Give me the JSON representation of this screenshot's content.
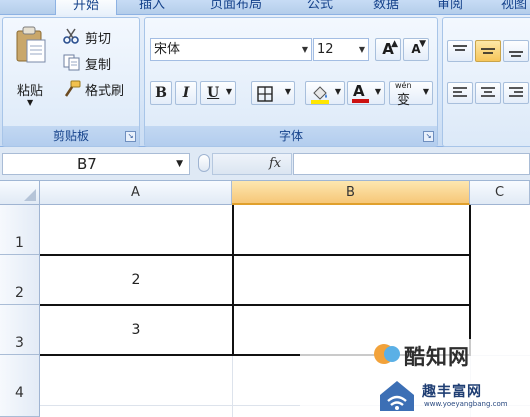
{
  "tabs": [
    {
      "label": "开始",
      "active": true
    },
    {
      "label": "插入",
      "active": false
    },
    {
      "label": "页面布局",
      "active": false
    },
    {
      "label": "公式",
      "active": false
    },
    {
      "label": "数据",
      "active": false
    },
    {
      "label": "审阅",
      "active": false
    },
    {
      "label": "视图",
      "active": false
    }
  ],
  "clipboard": {
    "paste_label": "粘贴",
    "cut_label": "剪切",
    "copy_label": "复制",
    "format_painter_label": "格式刷",
    "group_label": "剪贴板"
  },
  "font": {
    "font_name": "宋体",
    "font_size": "12",
    "grow_label": "A",
    "shrink_label": "A",
    "bold_label": "B",
    "italic_label": "I",
    "underline_label": "U",
    "font_color_label": "A",
    "phonetic_top": "wén",
    "phonetic_char": "变",
    "group_label": "字体",
    "font_color": "#cc1111",
    "fill_color": "#ffe600"
  },
  "formula_bar": {
    "name_box": "B7",
    "fx_label": "fx",
    "formula_value": ""
  },
  "sheet": {
    "columns": [
      "A",
      "B",
      "C"
    ],
    "active_column": "B",
    "rows": [
      {
        "header": "1",
        "a": "",
        "b": ""
      },
      {
        "header": "2",
        "a": "2",
        "b": ""
      },
      {
        "header": "3",
        "a": "3",
        "b": ""
      },
      {
        "header": "4",
        "a": "",
        "b": ""
      }
    ]
  },
  "watermark": {
    "brand_text": "酷知网",
    "site_text": "趣丰富网",
    "site_url": "www.yoeyangbang.com"
  }
}
